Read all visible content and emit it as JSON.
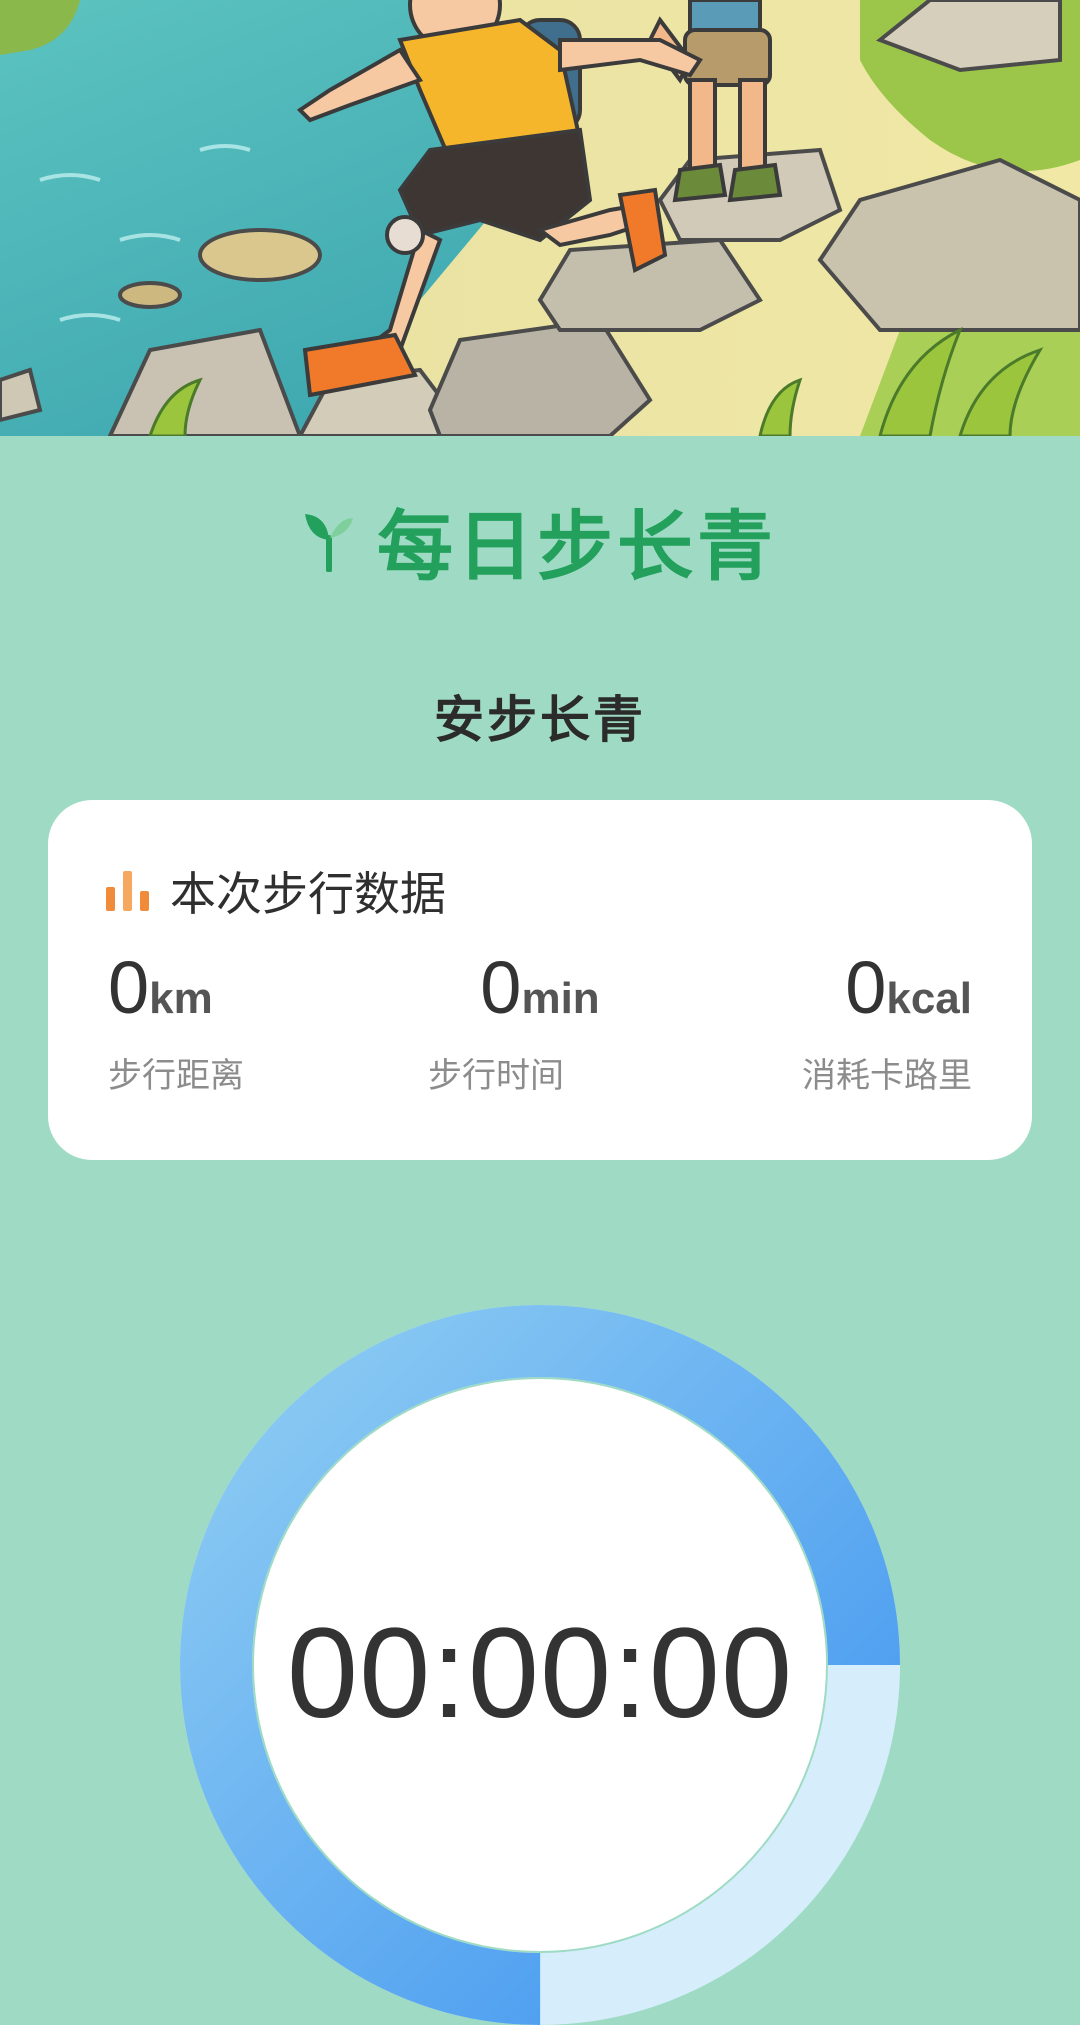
{
  "hero": {
    "image_alt": "两个背着背包的孩子在河边石头上徒步"
  },
  "header": {
    "title": "每日步长青",
    "logo_icon": "sprout-icon",
    "accent_color": "#22a05c"
  },
  "subtitle": "安步长青",
  "stats_card": {
    "title": "本次步行数据",
    "title_icon": "bar-chart-icon",
    "stats": [
      {
        "value": "0",
        "unit": "km",
        "label": "步行距离"
      },
      {
        "value": "0",
        "unit": "min",
        "label": "步行时间"
      },
      {
        "value": "0",
        "unit": "kcal",
        "label": "消耗卡路里"
      }
    ]
  },
  "timer": {
    "display": "00:00:00",
    "progress_fraction": 0.75,
    "ring_color": "#4a9cf2",
    "track_color": "#d6eefb"
  }
}
